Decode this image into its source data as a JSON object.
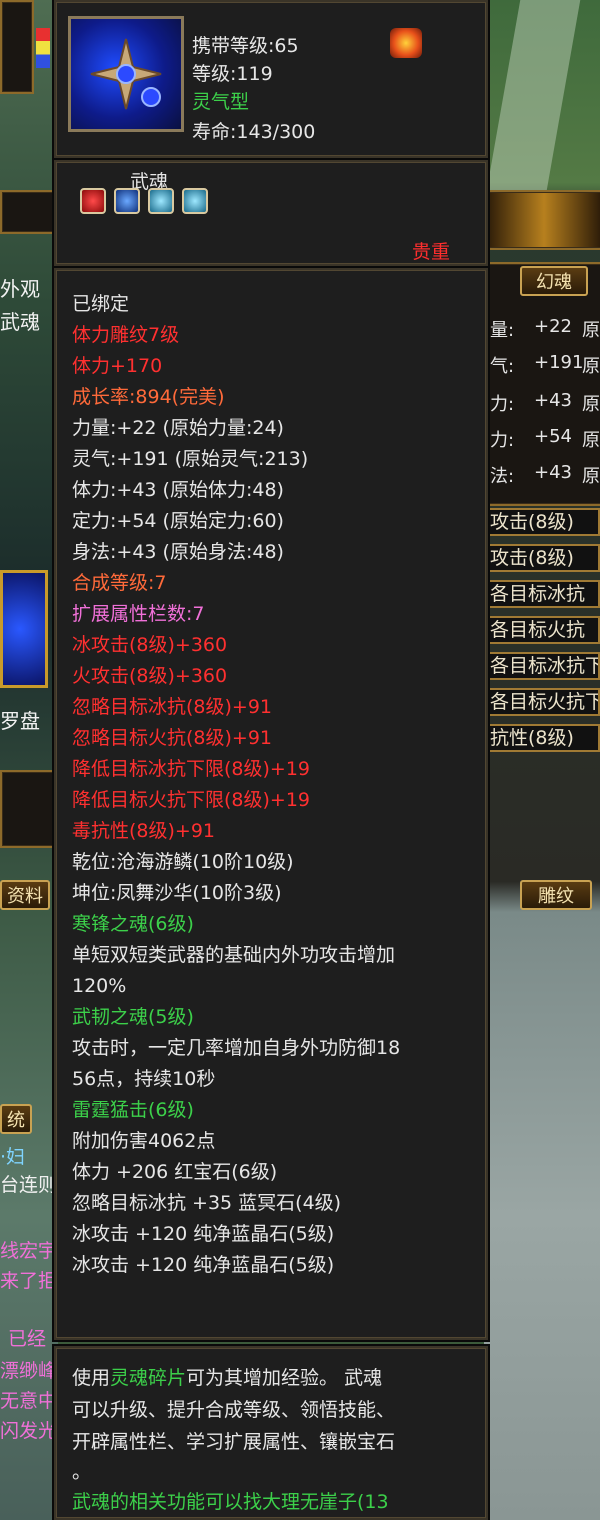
{
  "header_panel": {
    "carry_level": "携带等级:65",
    "level": "等级:119",
    "type": "灵气型",
    "lifespan": "寿命:143/300",
    "soul_label": "武魂",
    "valuable": "贵重"
  },
  "attributes": [
    {
      "text": "已绑定",
      "color": "#e6e6e6"
    },
    {
      "text": "体力雕纹7级",
      "color": "#ff3030"
    },
    {
      "text": "体力+170",
      "color": "#ff3030"
    },
    {
      "text": "成长率:894(完美)",
      "color": "#ff6a3a"
    },
    {
      "text": "力量:+22 (原始力量:24)",
      "color": "#e6e6e6"
    },
    {
      "text": "灵气:+191 (原始灵气:213)",
      "color": "#e6e6e6"
    },
    {
      "text": "体力:+43 (原始体力:48)",
      "color": "#e6e6e6"
    },
    {
      "text": "定力:+54 (原始定力:60)",
      "color": "#e6e6e6"
    },
    {
      "text": "身法:+43 (原始身法:48)",
      "color": "#e6e6e6"
    },
    {
      "text": "合成等级:7",
      "color": "#ff6a3a"
    },
    {
      "text": "扩展属性栏数:7",
      "color": "#f070d8"
    },
    {
      "text": "冰攻击(8级)+360",
      "color": "#ff3030"
    },
    {
      "text": "火攻击(8级)+360",
      "color": "#ff3030"
    },
    {
      "text": "忽略目标冰抗(8级)+91",
      "color": "#ff3030"
    },
    {
      "text": "忽略目标火抗(8级)+91",
      "color": "#ff3030"
    },
    {
      "text": "降低目标冰抗下限(8级)+19",
      "color": "#ff3030"
    },
    {
      "text": "降低目标火抗下限(8级)+19",
      "color": "#ff3030"
    },
    {
      "text": "毒抗性(8级)+91",
      "color": "#ff3030"
    },
    {
      "text": "乾位:沧海游鳞(10阶10级)",
      "color": "#e6e6e6"
    },
    {
      "text": "坤位:凤舞沙华(10阶3级)",
      "color": "#e6e6e6"
    },
    {
      "text": "寒锋之魂(6级)",
      "color": "#3cd04a"
    },
    {
      "text": "单短双短类武器的基础内外功攻击增加",
      "color": "#e6e6e6"
    },
    {
      "text": "120%",
      "color": "#e6e6e6"
    },
    {
      "text": "武韧之魂(5级)",
      "color": "#3cd04a"
    },
    {
      "text": "攻击时，一定几率增加自身外功防御18",
      "color": "#e6e6e6"
    },
    {
      "text": "56点，持续10秒",
      "color": "#e6e6e6"
    },
    {
      "text": "雷霆猛击(6级)",
      "color": "#3cd04a"
    },
    {
      "text": "附加伤害4062点",
      "color": "#e6e6e6"
    },
    {
      "text": "体力 +206 红宝石(6级)",
      "color": "#e6e6e6"
    },
    {
      "text": "忽略目标冰抗 +35 蓝冥石(4级)",
      "color": "#e6e6e6"
    },
    {
      "text": "冰攻击 +120 纯净蓝晶石(5级)",
      "color": "#e6e6e6"
    },
    {
      "text": "冰攻击 +120 纯净蓝晶石(5级)",
      "color": "#e6e6e6"
    }
  ],
  "description": {
    "line1_a": "使用",
    "line1_link": "灵魂碎片",
    "line1_b": "可为其增加经验。 武魂",
    "line2": "可以升级、提升合成等级、领悟技能、",
    "line3": "开辟属性栏、学习扩展属性、镶嵌宝石",
    "line4": "。",
    "line5": "武魂的相关功能可以找大理无崖子(13"
  },
  "background": {
    "left_labels": [
      "外观",
      "武魂",
      "罗盘",
      "资料",
      "统"
    ],
    "chat_lines": [
      {
        "text": "·妇",
        "color": "#7fd4ff"
      },
      {
        "text": "台连则",
        "color": "#f0f0f0"
      },
      {
        "text": "线宏宇",
        "color": "#f070d8"
      },
      {
        "text": "来了拒",
        "color": "#f070d8"
      },
      {
        "text": "已经",
        "color": "#f070d8"
      },
      {
        "text": "漂缈峰",
        "color": "#f070d8"
      },
      {
        "text": "无意中",
        "color": "#f070d8"
      },
      {
        "text": "闪发光",
        "color": "#f070d8"
      }
    ],
    "tab_huanhun": "幻魂",
    "tab_diaowen": "雕纹",
    "right_stats": [
      {
        "label": "量:",
        "value": "+22",
        "tail": "原"
      },
      {
        "label": "气:",
        "value": "+191",
        "tail": "原"
      },
      {
        "label": "力:",
        "value": "+43",
        "tail": "原"
      },
      {
        "label": "力:",
        "value": "+54",
        "tail": "原"
      },
      {
        "label": "法:",
        "value": "+43",
        "tail": "原"
      }
    ],
    "right_bars": [
      "攻击(8级)",
      "攻击(8级)",
      "各目标冰抗",
      "各目标火抗",
      "各目标冰抗下",
      "各目标火抗下",
      "抗性(8级)"
    ]
  }
}
